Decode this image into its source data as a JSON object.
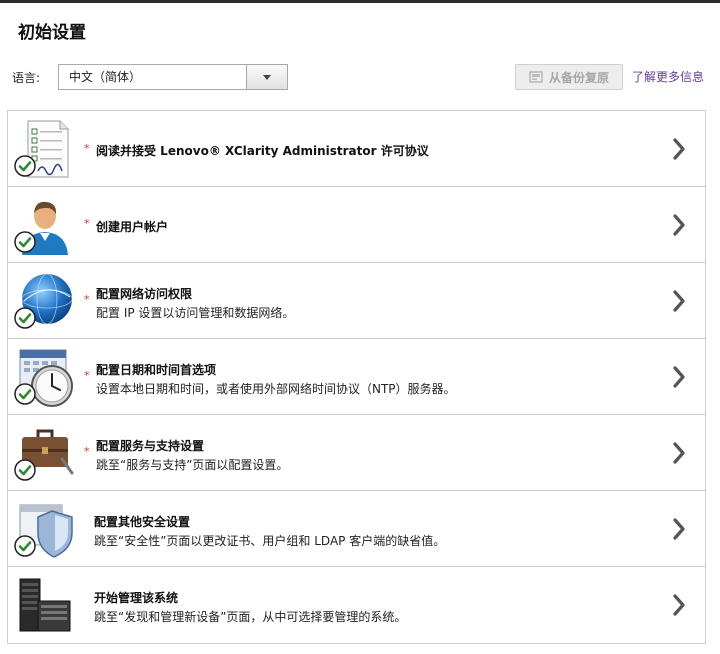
{
  "page": {
    "title": "初始设置"
  },
  "language": {
    "label": "语言:",
    "selected": "中文（简体）"
  },
  "toolbar": {
    "restore_label": "从备份复原",
    "more_info_label": "了解更多信息"
  },
  "colors": {
    "check": "#2e8b2e",
    "required": "#c0392b",
    "link": "#6a3d97"
  },
  "tasks": [
    {
      "icon": "license-document-icon",
      "required": true,
      "completed": true,
      "title": "阅读并接受 Lenovo® XClarity Administrator 许可协议",
      "description": ""
    },
    {
      "icon": "user-account-icon",
      "required": true,
      "completed": true,
      "title": "创建用户帐户",
      "description": ""
    },
    {
      "icon": "network-globe-icon",
      "required": true,
      "completed": true,
      "title": "配置网络访问权限",
      "description": "配置 IP 设置以访问管理和数据网络。"
    },
    {
      "icon": "calendar-clock-icon",
      "required": true,
      "completed": true,
      "title": "配置日期和时间首选项",
      "description": "设置本地日期和时间，或者使用外部网络时间协议（NTP）服务器。"
    },
    {
      "icon": "toolbox-icon",
      "required": true,
      "completed": true,
      "title": "配置服务与支持设置",
      "description": "跳至“服务与支持”页面以配置设置。"
    },
    {
      "icon": "security-shield-icon",
      "required": false,
      "completed": true,
      "title": "配置其他安全设置",
      "description": "跳至“安全性”页面以更改证书、用户组和 LDAP 客户端的缺省值。"
    },
    {
      "icon": "server-rack-icon",
      "required": false,
      "completed": false,
      "title": "开始管理该系统",
      "description": "跳至“发现和管理新设备”页面，从中可选择要管理的系统。"
    }
  ]
}
